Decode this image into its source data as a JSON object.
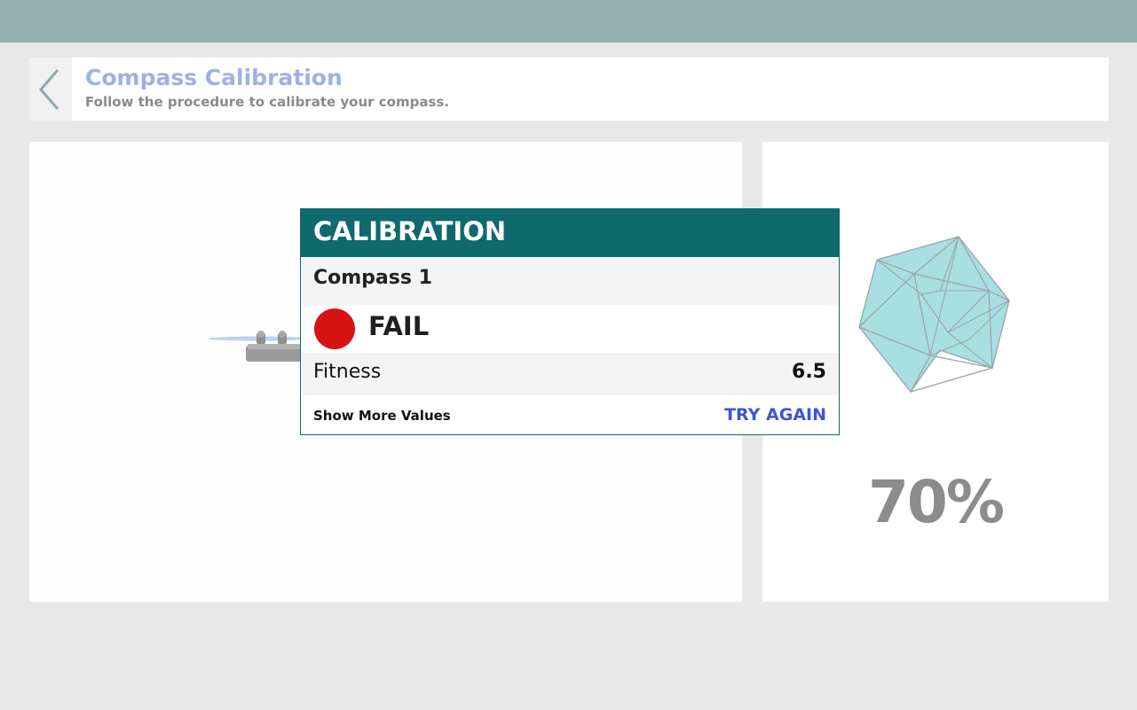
{
  "header": {
    "title": "Compass Calibration",
    "subtitle": "Follow the procedure to calibrate your compass.",
    "back_icon": "chevron-left-icon"
  },
  "dialog": {
    "title": "CALIBRATION",
    "compass_label": "Compass 1",
    "status": {
      "label": "FAIL",
      "color": "#d71313"
    },
    "fitness": {
      "label": "Fitness",
      "value": "6.5"
    },
    "show_more_label": "Show More Values",
    "try_again_label": "TRY AGAIN"
  },
  "progress": {
    "label": "70%",
    "value": 70
  },
  "colors": {
    "topbar": "#97b0b3",
    "dialog_header": "#0e6a6c",
    "title_accent": "#9fb0e8",
    "link_accent": "#3a56d4",
    "sphere_fill": "#a8dfe3"
  }
}
